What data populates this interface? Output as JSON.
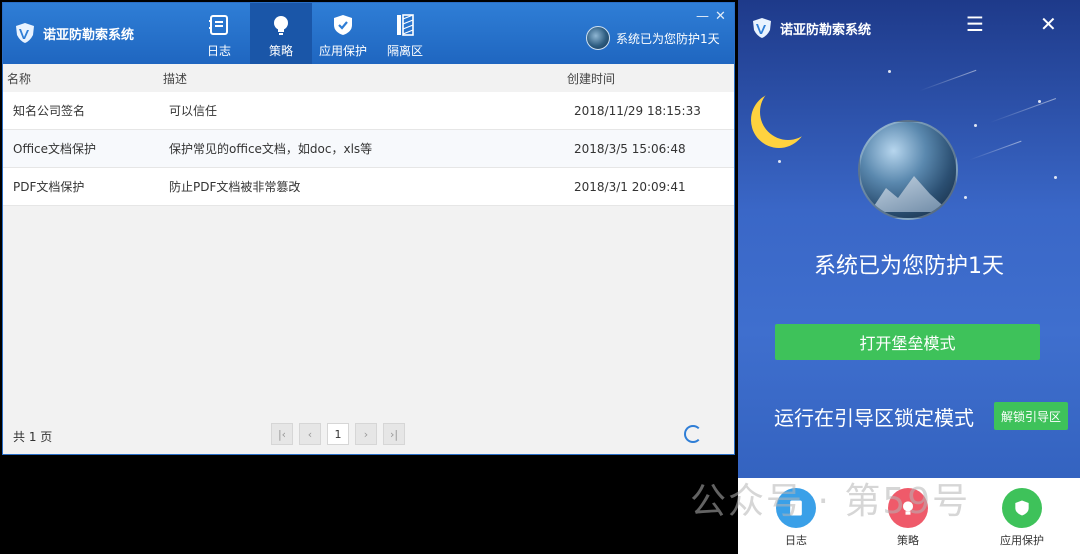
{
  "app": {
    "title": "诺亚防勒索系统"
  },
  "nav": {
    "tabs": [
      {
        "label": "日志",
        "icon": "log-icon"
      },
      {
        "label": "策略",
        "icon": "bulb-icon"
      },
      {
        "label": "应用保护",
        "icon": "shield-check-icon"
      },
      {
        "label": "隔离区",
        "icon": "quarantine-icon"
      }
    ],
    "active": "策略"
  },
  "status": {
    "text": "系统已为您防护1天"
  },
  "table": {
    "columns": [
      "名称",
      "描述",
      "创建时间"
    ],
    "rows": [
      {
        "name": "知名公司签名",
        "desc": "可以信任",
        "created": "2018/11/29 18:15:33"
      },
      {
        "name": "Office文档保护",
        "desc": "保护常见的office文档，如doc，xls等",
        "created": "2018/3/5 15:06:48"
      },
      {
        "name": "PDF文档保护",
        "desc": "防止PDF文档被非常篡改",
        "created": "2018/3/1 20:09:41"
      }
    ]
  },
  "footer": {
    "pages_text": "共 1 页",
    "current_page": "1",
    "pager": {
      "first": "|‹",
      "prev": "‹",
      "next": "›",
      "last": "›|"
    }
  },
  "panel": {
    "title": "诺亚防勒索系统",
    "headline": "系统已为您防护1天",
    "fortress_button": "打开堡垒模式",
    "boot_mode_text": "运行在引导区锁定模式",
    "unlock_button": "解锁引导区",
    "bottom_nav": [
      {
        "label": "日志",
        "color": "#3aa0e8"
      },
      {
        "label": "策略",
        "color": "#ef5a6a"
      },
      {
        "label": "应用保护",
        "color": "#3ec25a"
      }
    ]
  },
  "watermark": {
    "text": "公众号 · 第59号"
  },
  "colors": {
    "primary": "#2f7ed6",
    "green": "#3ec25a"
  }
}
